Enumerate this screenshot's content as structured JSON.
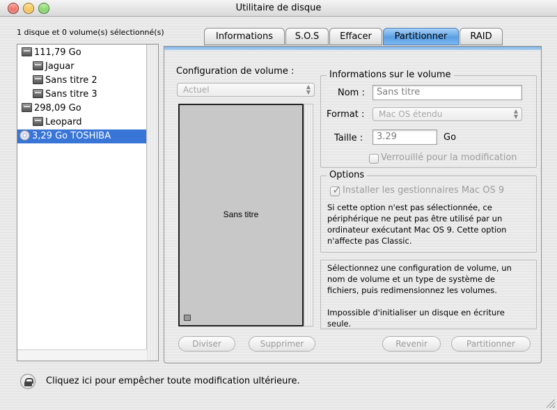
{
  "window": {
    "title": "Utilitaire de disque"
  },
  "selection_label": "1 disque et 0 volume(s) sélectionné(s)",
  "sidebar": {
    "items": [
      {
        "label": "111,79 Go",
        "icon": "hard-disk-icon",
        "level": 0
      },
      {
        "label": "Jaguar",
        "icon": "volume-icon",
        "level": 1
      },
      {
        "label": "Sans titre 2",
        "icon": "volume-icon",
        "level": 1
      },
      {
        "label": "Sans titre 3",
        "icon": "volume-icon",
        "level": 1
      },
      {
        "label": "298,09 Go",
        "icon": "hard-disk-icon",
        "level": 0
      },
      {
        "label": "Leopard",
        "icon": "volume-icon",
        "level": 1
      },
      {
        "label": "3,29 Go TOSHIBA",
        "icon": "cd-icon",
        "level": 0,
        "selected": true
      }
    ]
  },
  "tabs": [
    {
      "label": "Informations"
    },
    {
      "label": "S.O.S"
    },
    {
      "label": "Effacer"
    },
    {
      "label": "Partitionner",
      "active": true
    },
    {
      "label": "RAID"
    }
  ],
  "partition": {
    "config_label": "Configuration de volume :",
    "config_value": "Actuel",
    "volume_name_in_map": "Sans titre",
    "info_title": "Informations sur le volume",
    "name_label": "Nom :",
    "name_value": "Sans titre",
    "format_label": "Format :",
    "format_value": "Mac OS étendu",
    "size_label": "Taille :",
    "size_value": "3.29",
    "size_unit": "Go",
    "locked_label": "Verrouillé pour la modification",
    "options_title": "Options",
    "install_drivers_label": "Installer les gestionnaires Mac OS 9",
    "install_drivers_checked": true,
    "options_desc": [
      "Si cette option n'est pas sélectionnée, ce",
      "périphérique ne peut pas être utilisé par un",
      "ordinateur exécutant Mac OS 9. Cette option",
      "n'affecte pas Classic."
    ],
    "help_desc": [
      "Sélectionnez une configuration de volume, un",
      "nom de volume et un type de système de",
      "fichiers, puis redimensionnez les volumes."
    ],
    "help_desc_2": [
      "Impossible d'initialiser un disque en écriture",
      "seule."
    ],
    "split_button": "Diviser",
    "delete_button": "Supprimer",
    "revert_button": "Revenir",
    "partition_button": "Partitionner"
  },
  "footer": {
    "lock_text": "Cliquez ici pour empêcher toute modification ultérieure."
  },
  "colors": {
    "selection": "#3875d7",
    "active_tab": "#5a9fe4"
  }
}
